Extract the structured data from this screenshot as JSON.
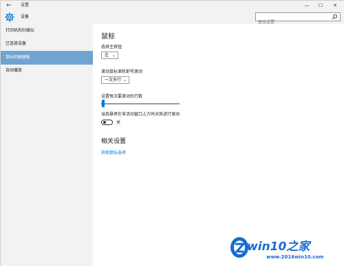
{
  "window": {
    "title": "设置",
    "controls": {
      "minimize": "—",
      "maximize": "☐",
      "close": "✕"
    }
  },
  "header": {
    "title": "设备",
    "search_placeholder": "查找设置"
  },
  "sidebar": {
    "items": [
      {
        "label": "打印机和扫描仪",
        "active": false
      },
      {
        "label": "已连接设备",
        "active": false
      },
      {
        "label": "鼠标和触摸板",
        "active": true
      },
      {
        "label": "自动播放",
        "active": false
      }
    ]
  },
  "content": {
    "title": "鼠标",
    "primary_button_label": "选择主按钮",
    "primary_button_value": "左",
    "scroll_label": "滚动鼠标滚轮即可滚动",
    "scroll_value": "一次多行",
    "lines_label": "设置每次要滚动的行数",
    "lines_slider_value": 0.03,
    "inactive_scroll_label": "当我悬停在非活动窗口上方时对其进行滚动",
    "inactive_scroll_state": "关",
    "related_title": "相关设置",
    "other_options_link": "其他鼠标选项"
  },
  "watermark": {
    "logo_text": "win10之家",
    "url": "www.2016win10.com"
  },
  "colors": {
    "accent": "#0078d7",
    "sidebar_active": "#6fa3d2",
    "chrome_bg": "#f2f2f2"
  }
}
